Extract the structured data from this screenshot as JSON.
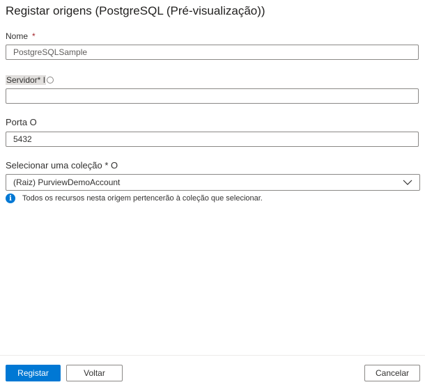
{
  "dialog": {
    "title": "Registar origens (PostgreSQL (Pré-visualização))"
  },
  "form": {
    "name_label": "Nome",
    "name_required": "*",
    "name_value": "PostgreSQLSample",
    "server_label": "Servidor* I",
    "server_value": "",
    "port_label": "Porta O",
    "port_value": "5432",
    "collection_label": "Selecionar uma coleção * O",
    "collection_value": "(Raiz) PurviewDemoAccount",
    "collection_info": "Todos os recursos nesta origem pertencerão à coleção que selecionar."
  },
  "buttons": {
    "register": "Registar",
    "back": "Voltar",
    "cancel": "Cancelar"
  },
  "icons": {
    "info": "info-icon",
    "chevron": "chevron-down-icon"
  },
  "colors": {
    "primary": "#0078d4",
    "required": "#a4262c",
    "border": "#8a8886"
  }
}
